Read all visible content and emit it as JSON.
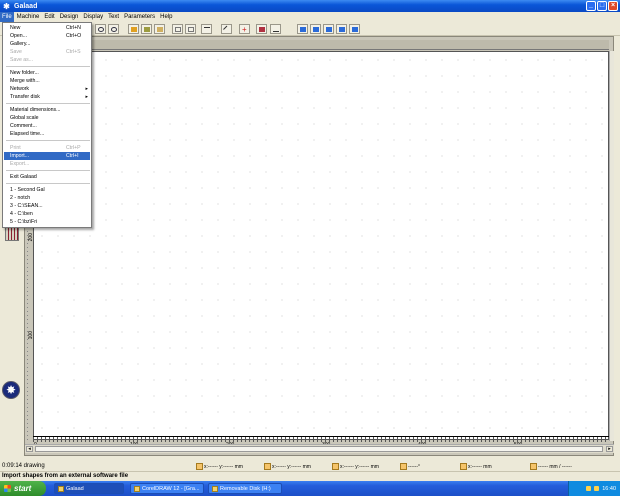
{
  "window": {
    "title": "Galaad"
  },
  "menubar": [
    "File",
    "Machine",
    "Edit",
    "Design",
    "Display",
    "Text",
    "Parameters",
    "Help"
  ],
  "file_menu": {
    "items": [
      {
        "label": "New",
        "shortcut": "Ctrl+N",
        "disabled": false
      },
      {
        "label": "Open...",
        "shortcut": "Ctrl+O",
        "disabled": false
      },
      {
        "label": "Gallery...",
        "shortcut": "",
        "disabled": false
      },
      {
        "label": "Save",
        "shortcut": "Ctrl+S",
        "disabled": true
      },
      {
        "label": "Save as...",
        "shortcut": "",
        "disabled": true
      },
      {
        "label": "New folder...",
        "shortcut": "",
        "disabled": false
      },
      {
        "label": "Merge with...",
        "shortcut": "",
        "disabled": false
      },
      {
        "label": "Network",
        "shortcut": "",
        "disabled": false,
        "submenu": true
      },
      {
        "label": "Transfer disk",
        "shortcut": "",
        "disabled": false,
        "submenu": true
      },
      {
        "label": "Material dimensions...",
        "shortcut": "",
        "disabled": false
      },
      {
        "label": "Global scale",
        "shortcut": "",
        "disabled": false
      },
      {
        "label": "Comment...",
        "shortcut": "",
        "disabled": false
      },
      {
        "label": "Elapsed time...",
        "shortcut": "",
        "disabled": false
      },
      {
        "label": "Print",
        "shortcut": "Ctrl+P",
        "disabled": true
      },
      {
        "label": "Import...",
        "shortcut": "Ctrl+I",
        "disabled": false,
        "selected": true
      },
      {
        "label": "Export...",
        "shortcut": "",
        "disabled": true
      },
      {
        "label": "Exit Galaad",
        "shortcut": "",
        "disabled": false
      },
      {
        "label": "1 - Second Gal",
        "shortcut": "",
        "disabled": false
      },
      {
        "label": "2 - notch",
        "shortcut": "",
        "disabled": false
      },
      {
        "label": "3 - C:\\SEAN...",
        "shortcut": "",
        "disabled": false
      },
      {
        "label": "4 - C:\\ben",
        "shortcut": "",
        "disabled": false
      },
      {
        "label": "5 - C:\\bz\\Fri",
        "shortcut": "",
        "disabled": false
      }
    ]
  },
  "ruler": {
    "bottom_labels": [
      "0",
      "100",
      "200",
      "300",
      "400",
      "500"
    ],
    "left_labels": [
      "200",
      "100"
    ]
  },
  "status": {
    "text": "0:09:14 drawing",
    "hint": "Import shapes from an external software file",
    "coord_fields": [
      {
        "x": "x:------",
        "y": "y:------",
        "unit": "mm"
      },
      {
        "x": "x:------",
        "y": "y:------",
        "unit": "mm"
      },
      {
        "x": "x:------",
        "y": "y:------",
        "unit": "mm"
      },
      {
        "x": "x:------",
        "y": "y:------",
        "unit": "mm"
      },
      {
        "x": "x:------",
        "y": "y:------",
        "unit": "mm"
      }
    ],
    "extra_fields": [
      "------°",
      "------ mm / ------"
    ]
  },
  "taskbar": {
    "start_label": "start",
    "tasks": [
      {
        "label": "Galaad",
        "active": true
      },
      {
        "label": "CorelDRAW 12 - [Gra...",
        "active": false
      },
      {
        "label": "Removable Disk (H:)",
        "active": false
      }
    ],
    "clock": "16:40"
  },
  "colors": {
    "accent": "#316ac5",
    "titlebar": "#0a56d8",
    "taskbar": "#245edb",
    "start": "#2e8c2a"
  }
}
